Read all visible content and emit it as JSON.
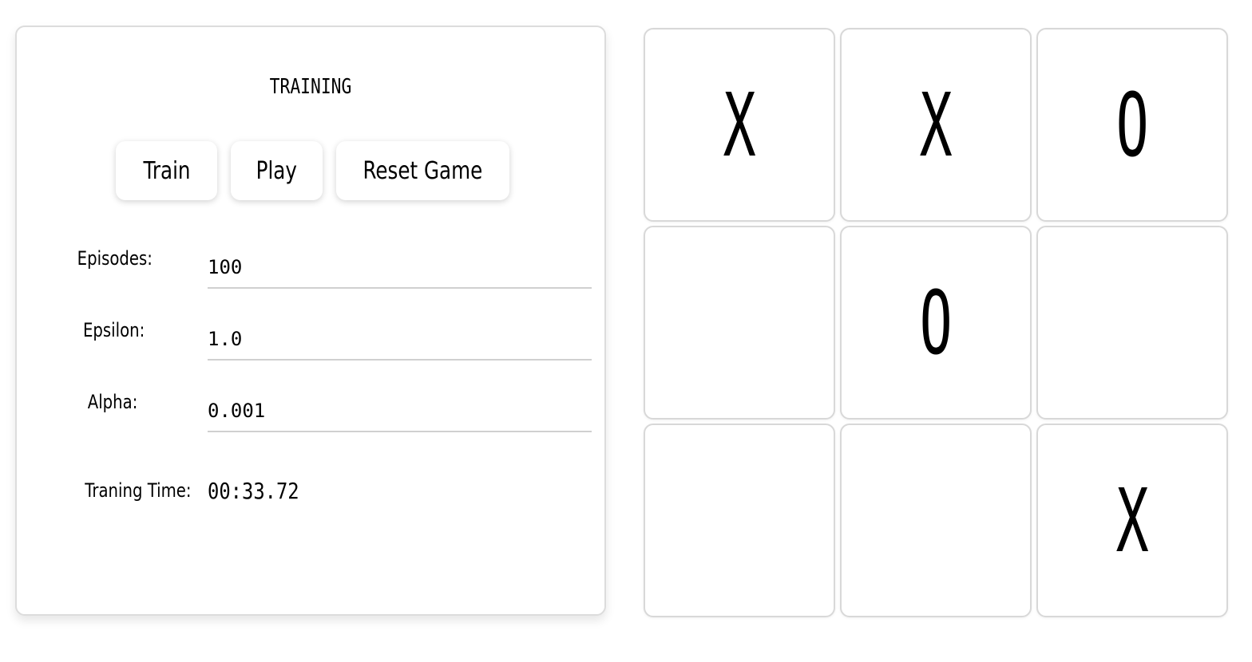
{
  "training": {
    "title": "TRAINING",
    "buttons": {
      "train": "Train",
      "play": "Play",
      "reset": "Reset Game"
    },
    "fields": {
      "episodes_label": "Episodes:",
      "episodes_value": "100",
      "epsilon_label": "Epsilon:",
      "epsilon_value": "1.0",
      "alpha_label": "Alpha:",
      "alpha_value": "0.001"
    },
    "time_label": "Traning Time:",
    "time_value": "00:33.72"
  },
  "board": {
    "cells": [
      "X",
      "X",
      "O",
      "",
      "O",
      "",
      "",
      "",
      "X"
    ]
  }
}
